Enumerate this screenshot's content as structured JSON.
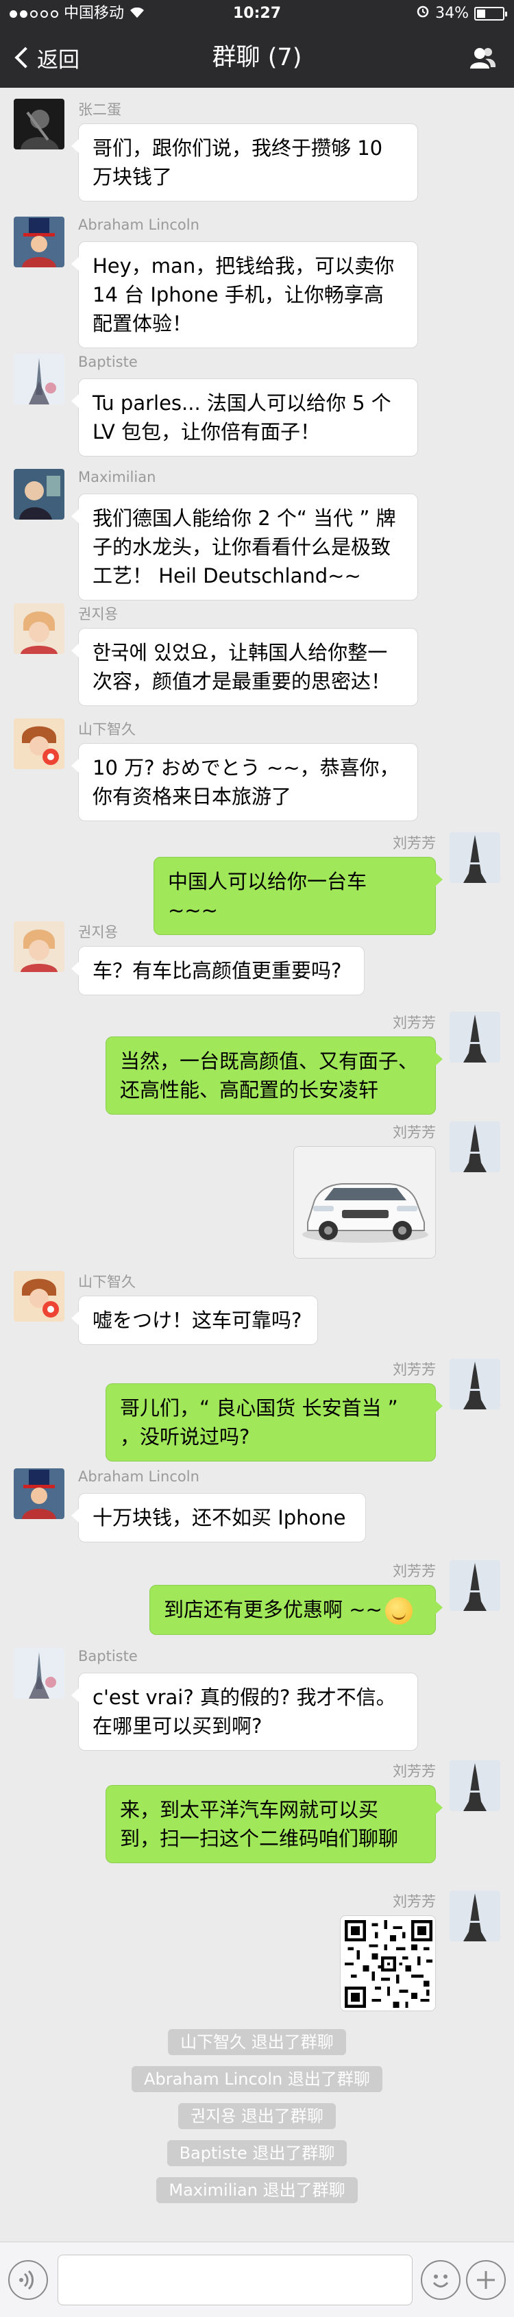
{
  "status_bar": {
    "carrier": "中国移动",
    "time": "10:27",
    "battery": "34%",
    "battery_level": 0.34
  },
  "nav": {
    "back_label": "返回",
    "title": "群聊 (7)",
    "members_icon": "group-members-icon"
  },
  "messages": [
    {
      "side": "in",
      "sender": "张二蛋",
      "lines": [
        "哥们，跟你们说，我终于攒够 10",
        "万块钱了"
      ]
    },
    {
      "side": "in",
      "sender": "Abraham Lincoln",
      "lines": [
        "Hey，man，把钱给我，可以卖你",
        "14 台 Iphone 手机，让你畅享高",
        "配置体验！"
      ]
    },
    {
      "side": "in",
      "sender": "Baptiste",
      "lines": [
        "Tu parles... 法国人可以给你 5 个",
        "LV 包包，让你倍有面子！"
      ]
    },
    {
      "side": "in",
      "sender": "Maximilian",
      "lines": [
        "我们德国人能给你 2 个“ 当代 ” 牌",
        "子的水龙头，让你看看什么是极致",
        "工艺！ Heil Deutschland~~"
      ]
    },
    {
      "side": "in",
      "sender": "권지용",
      "lines": [
        "한국에 있었요，让韩国人给你整一",
        "次容，颜值才是最重要的思密达！"
      ]
    },
    {
      "side": "in",
      "sender": "山下智久",
      "lines": [
        "10 万? おめでとう ~~，恭喜你，",
        "你有资格来日本旅游了"
      ]
    },
    {
      "side": "out",
      "sender": "刘芳芳",
      "lines": [
        "中国人可以给你一台车 ~~~"
      ]
    },
    {
      "side": "in",
      "sender": "권지용",
      "lines": [
        "车？有车比高颜值更重要吗?"
      ]
    },
    {
      "side": "out",
      "sender": "刘芳芳",
      "lines": [
        "当然，一台既高颜值、又有面子、",
        "还高性能、高配置的长安凌轩"
      ]
    },
    {
      "side": "out",
      "sender": "刘芳芳",
      "image": "car-photo"
    },
    {
      "side": "in",
      "sender": "山下智久",
      "lines": [
        "嘘をつけ！这车可靠吗?"
      ]
    },
    {
      "side": "out",
      "sender": "刘芳芳",
      "lines": [
        "哥儿们，“ 良心国货 长安首当 ”",
        "，没听说过吗?"
      ]
    },
    {
      "side": "in",
      "sender": "Abraham Lincoln",
      "lines": [
        "十万块钱，还不如买 Iphone"
      ]
    },
    {
      "side": "out",
      "sender": "刘芳芳",
      "lines": [
        "到店还有更多优惠啊 ~~"
      ],
      "emoji": "smiley"
    },
    {
      "side": "in",
      "sender": "Baptiste",
      "lines": [
        "c'est vrai? 真的假的? 我才不信。",
        "在哪里可以买到啊?"
      ]
    },
    {
      "side": "out",
      "sender": "刘芳芳",
      "lines": [
        "来，到太平洋汽车网就可以买",
        "到，扫一扫这个二维码咱们聊聊"
      ]
    },
    {
      "side": "out",
      "sender": "刘芳芳",
      "image": "qr-code"
    }
  ],
  "system_notices": [
    "山下智久 退出了群聊",
    "Abraham Lincoln 退出了群聊",
    "권지용 退出了群聊",
    "Baptiste 退出了群聊",
    "Maximilian 退出了群聊"
  ],
  "input_bar": {
    "placeholder": ""
  },
  "colors": {
    "header_bg": "#2b2b2d",
    "chat_bg": "#ebebeb",
    "sent_bubble": "#a0e75a",
    "received_bubble": "#ffffff"
  }
}
